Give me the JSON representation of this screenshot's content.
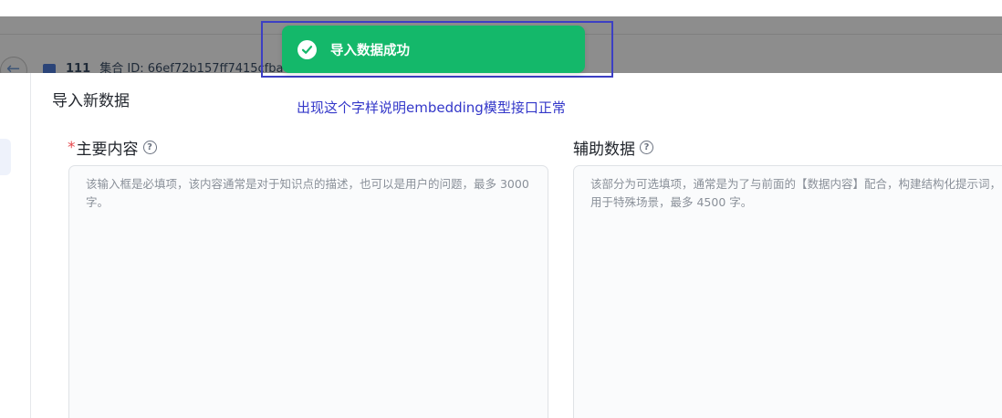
{
  "toast": {
    "message": "导入数据成功",
    "icon": "check-circle-icon",
    "color": "#14b86a"
  },
  "annotation": {
    "text": "出现这个字样说明embedding模型接口正常",
    "color": "#3337c9"
  },
  "breadcrumb": {
    "name": "111",
    "rest": "集合 ID: 66ef72b157ff7415cfba"
  },
  "modal": {
    "title": "导入新数据",
    "main_field": {
      "required_mark": "*",
      "label": "主要内容",
      "placeholder": "该输入框是必填项，该内容通常是对于知识点的描述，也可以是用户的问题，最多 3000 字。"
    },
    "aux_field": {
      "label": "辅助数据",
      "placeholder_line1": "该部分为可选填项，通常是为了与前面的【数据内容】配合，构建结构化提示词，",
      "placeholder_line2": "用于特殊场景，最多 4500 字。"
    }
  }
}
